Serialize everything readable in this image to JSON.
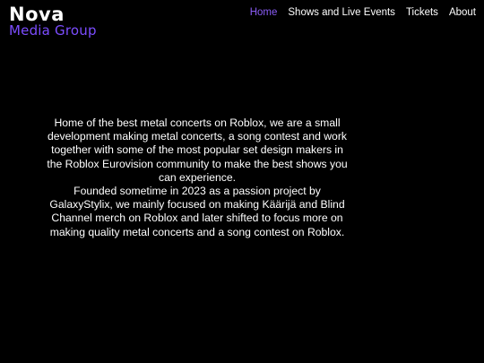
{
  "colors": {
    "background": "#000000",
    "text": "#ffffff",
    "accent": "#8a5cf6"
  },
  "logo": {
    "title": "Nova",
    "subtitle": "Media Group"
  },
  "nav": {
    "items": [
      {
        "label": "Home",
        "active": true
      },
      {
        "label": "Shows and Live Events",
        "active": false
      },
      {
        "label": "Tickets",
        "active": false
      },
      {
        "label": "About",
        "active": false
      }
    ]
  },
  "intro": {
    "paragraph1": "Home of the best metal concerts on Roblox, we are a small development making metal concerts, a song contest and work together with some of the most popular set design makers in the Roblox Eurovision community to make the best shows you can experience.",
    "paragraph2": "Founded sometime in 2023 as a passion project by GalaxyStylix, we mainly focused on making Käärijä and Blind Channel merch on Roblox and later shifted to focus more on making quality metal concerts and a song contest on Roblox."
  }
}
